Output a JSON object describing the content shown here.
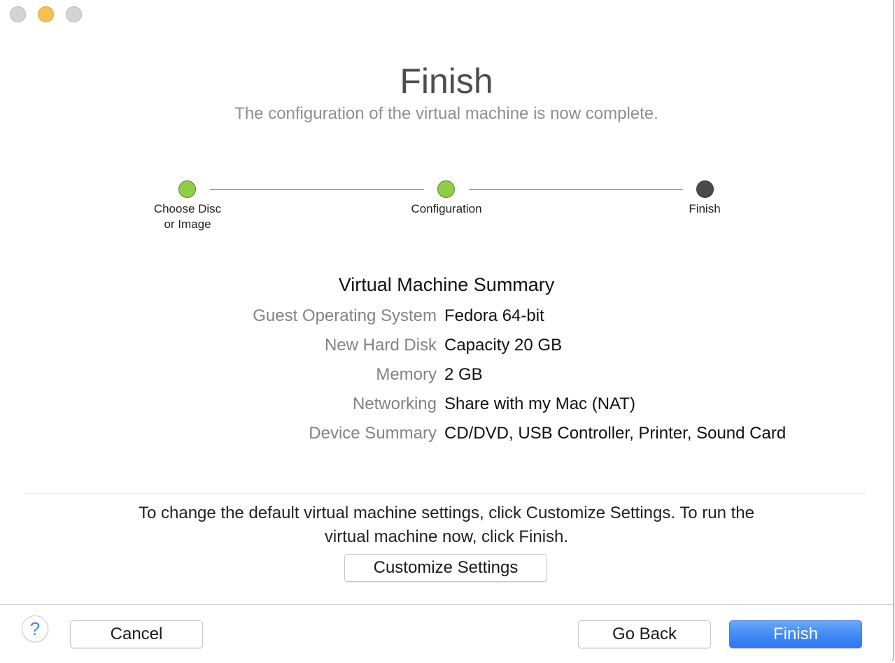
{
  "window": {
    "controls": [
      {
        "name": "close",
        "color": "#d4d4d4"
      },
      {
        "name": "minimize",
        "color": "#f6c152"
      },
      {
        "name": "zoom",
        "color": "#d4d4d4"
      }
    ]
  },
  "header": {
    "title": "Finish",
    "subtitle": "The configuration of the virtual machine is now complete."
  },
  "stepper": {
    "steps": [
      {
        "label_line1": "Choose Disc",
        "label_line2": "or Image",
        "status": "completed"
      },
      {
        "label_line1": "Configuration",
        "label_line2": "",
        "status": "completed"
      },
      {
        "label_line1": "Finish",
        "label_line2": "",
        "status": "current"
      }
    ],
    "colors": {
      "completed": "#8fcf45",
      "current": "#4a4a4a"
    }
  },
  "summary": {
    "title": "Virtual Machine Summary",
    "rows": [
      {
        "key": "Guest Operating System",
        "value": "Fedora 64-bit"
      },
      {
        "key": "New Hard Disk",
        "value": "Capacity 20 GB"
      },
      {
        "key": "Memory",
        "value": "2 GB"
      },
      {
        "key": "Networking",
        "value": "Share with my Mac (NAT)"
      },
      {
        "key": "Device Summary",
        "value": "CD/DVD, USB Controller, Printer, Sound Card"
      }
    ]
  },
  "info": {
    "line1": "To change the default virtual machine settings, click Customize Settings. To run the",
    "line2": "virtual machine now, click Finish.",
    "customize_label": "Customize Settings"
  },
  "footer": {
    "help_symbol": "?",
    "cancel_label": "Cancel",
    "go_back_label": "Go Back",
    "finish_label": "Finish",
    "accent_color": "#3f88f5"
  }
}
